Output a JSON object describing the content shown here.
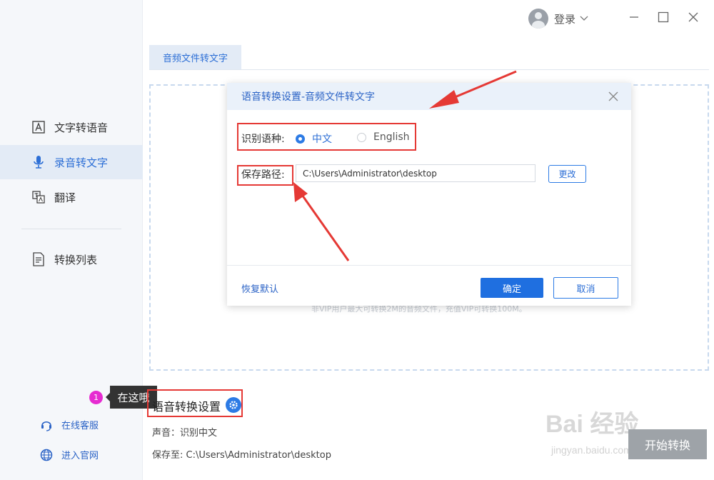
{
  "sidebar": {
    "items": [
      {
        "label": "文字转语音",
        "icon": "text-a-icon",
        "active": false
      },
      {
        "label": "录音转文字",
        "icon": "microphone-icon",
        "active": true
      },
      {
        "label": "翻译",
        "icon": "translate-icon",
        "active": false
      },
      {
        "label": "转换列表",
        "icon": "list-document-icon",
        "active": false
      }
    ],
    "links": [
      {
        "label": "在线客服",
        "icon": "headset-icon"
      },
      {
        "label": "进入官网",
        "icon": "globe-icon"
      }
    ]
  },
  "tooltip": {
    "badge": "1",
    "text": "在这哦"
  },
  "header": {
    "login_label": "登录"
  },
  "tabs": [
    {
      "label": "音频文件转文字"
    }
  ],
  "drop_area": {
    "hint": "非VIP用户最大可转换2M的音频文件，充值VIP可转换100M。"
  },
  "settings": {
    "title": "语音转换设置",
    "voice_label": "声音：识别中文",
    "save_label": "保存至: C:\\Users\\Administrator\\desktop"
  },
  "start_button": {
    "label": "开始转换"
  },
  "watermark": {
    "main": "Bai 经验",
    "sub": "jingyan.baidu.com"
  },
  "dialog": {
    "title": "语音转换设置-音频文件转文字",
    "language_label": "识别语种:",
    "language_options": [
      {
        "label": "中文",
        "selected": true
      },
      {
        "label": "English",
        "selected": false
      }
    ],
    "path_label": "保存路径:",
    "path_value": "C:\\Users\\Administrator\\desktop",
    "change_button": "更改",
    "restore_default": "恢复默认",
    "ok_button": "确定",
    "cancel_button": "取消"
  },
  "colors": {
    "accent": "#2d7be5",
    "annotation": "#e53935",
    "badge": "#e62bd1"
  }
}
